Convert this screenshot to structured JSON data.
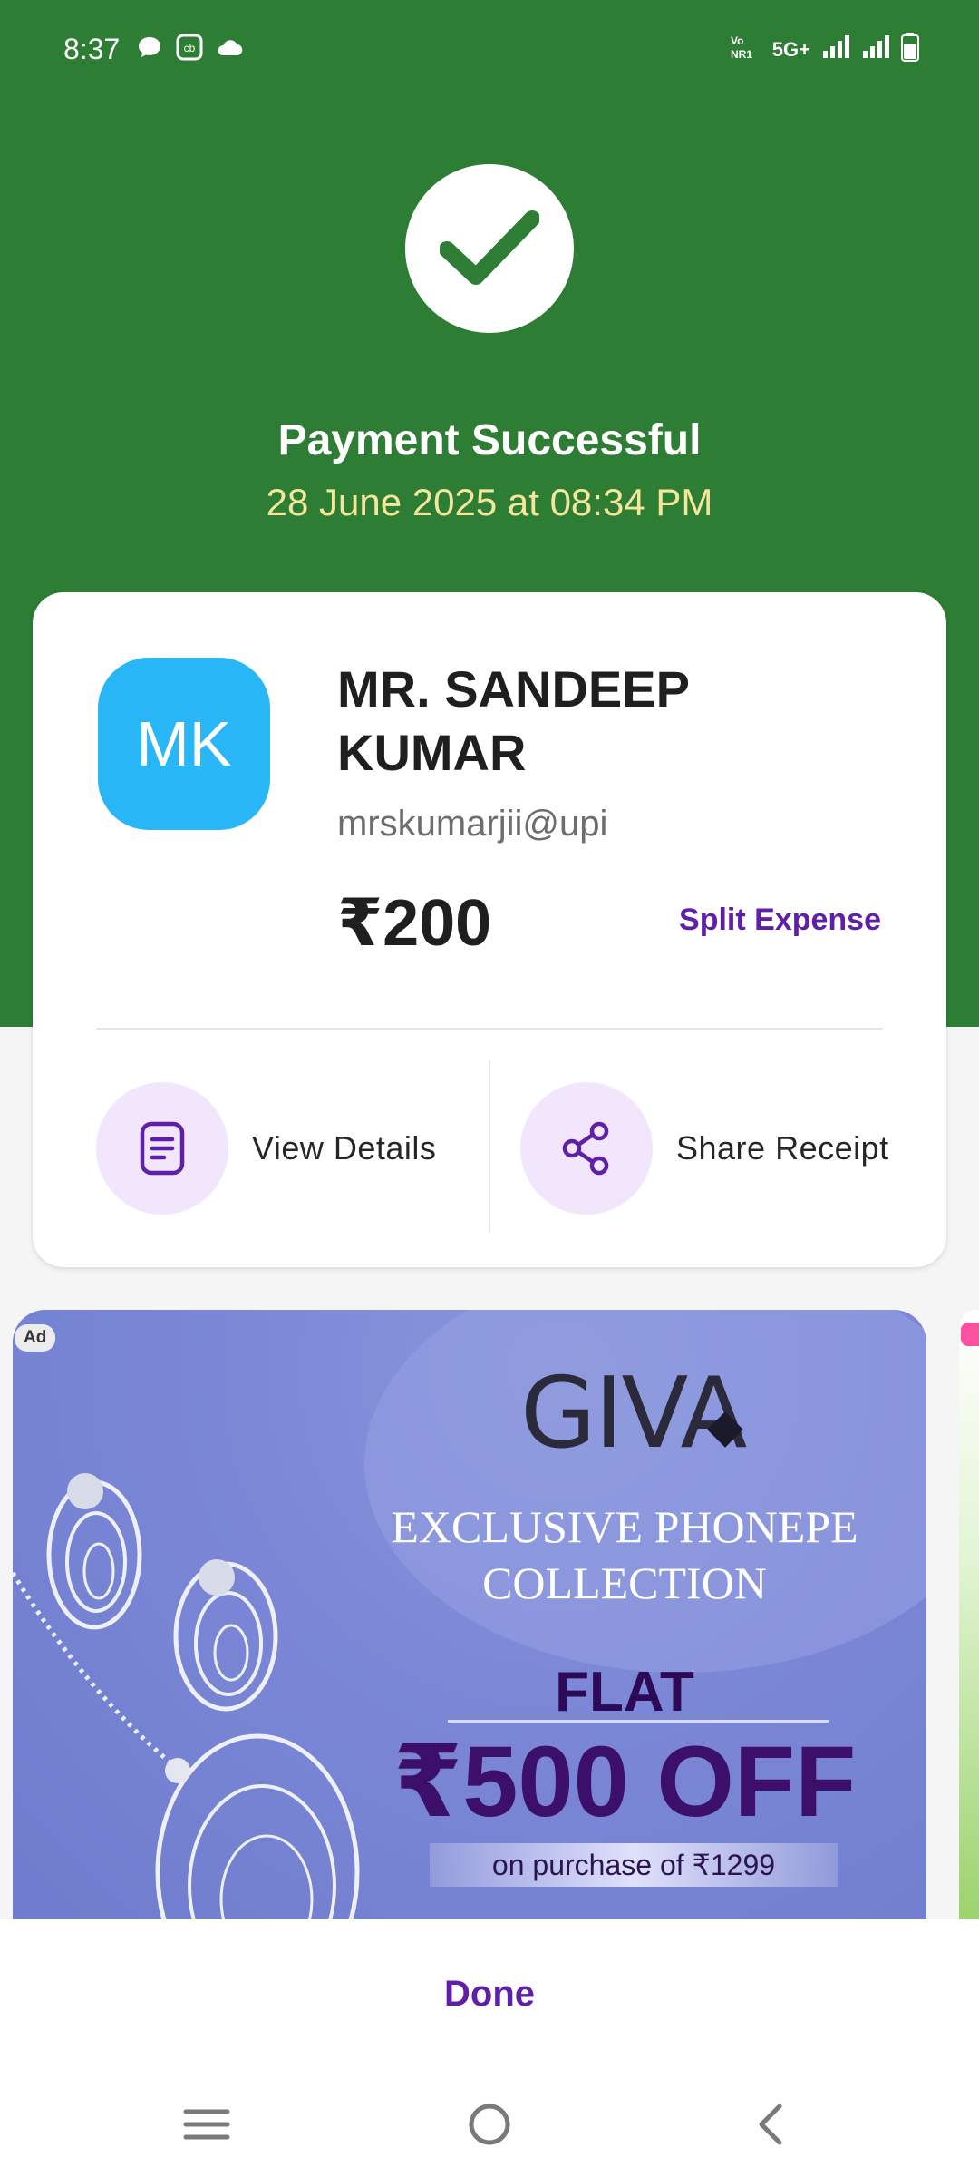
{
  "status_bar": {
    "time": "8:37",
    "network": "5G+",
    "left_icons": [
      "chat-icon",
      "cb-app-icon",
      "cloud-icon"
    ],
    "right_icons": [
      "volte-icon",
      "signal-icon",
      "signal-icon",
      "battery-icon"
    ]
  },
  "header": {
    "title": "Payment Successful",
    "datetime": "28 June 2025 at 08:34 PM"
  },
  "payee": {
    "initials": "MK",
    "name": "MR. SANDEEP KUMAR",
    "upi_id": "mrskumarjii@upi",
    "amount": "₹200",
    "split_label": "Split Expense"
  },
  "actions": {
    "view_details": "View Details",
    "share_receipt": "Share Receipt"
  },
  "ad": {
    "badge": "Ad",
    "brand": "GIVA",
    "line1": "EXCLUSIVE PHONEPE",
    "line2": "COLLECTION",
    "flat": "FLAT",
    "offer": "₹500 OFF",
    "purchase": "on purchase of ₹1299"
  },
  "footer": {
    "done_label": "Done"
  },
  "colors": {
    "header_green": "#2e7d34",
    "accent_purple": "#5f1fa8",
    "date_yellow": "#f5e79a",
    "avatar_blue": "#29b6f6"
  }
}
